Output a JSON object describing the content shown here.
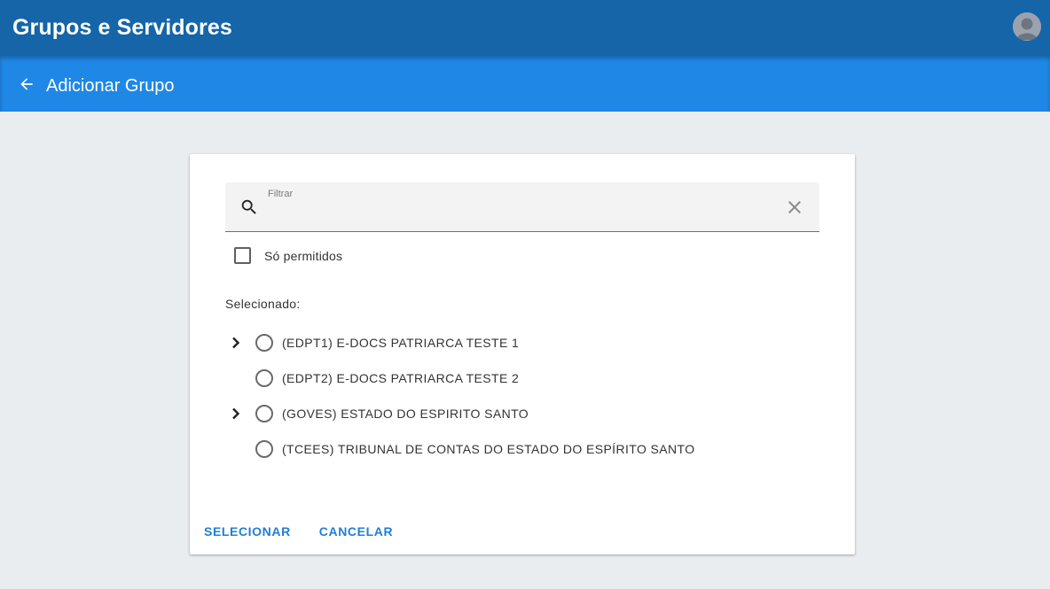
{
  "appbar": {
    "title": "Grupos e Servidores",
    "avatar_icon": "account-avatar-icon"
  },
  "subbar": {
    "back_icon": "arrow-back-icon",
    "title": "Adicionar Grupo"
  },
  "filter": {
    "label": "Filtrar",
    "value": "",
    "search_icon": "search-icon",
    "clear_icon": "close-icon"
  },
  "only_allowed": {
    "label": "Só permitidos",
    "checked": false
  },
  "selected_label": "Selecionado:",
  "tree": [
    {
      "label": "(EDPT1) E-DOCS PATRIARCA TESTE 1",
      "expandable": true,
      "selected": false
    },
    {
      "label": "(EDPT2) E-DOCS PATRIARCA TESTE 2",
      "expandable": false,
      "selected": false
    },
    {
      "label": "(GOVES) ESTADO DO ESPIRITO SANTO",
      "expandable": true,
      "selected": false
    },
    {
      "label": "(TCEES) TRIBUNAL DE CONTAS DO ESTADO DO ESPÍRITO SANTO",
      "expandable": false,
      "selected": false
    }
  ],
  "actions": {
    "select_label": "SELECIONAR",
    "cancel_label": "CANCELAR"
  },
  "colors": {
    "appbar": "#1565a8",
    "subbar": "#1f87e5",
    "background": "#eaedf0",
    "action_text": "#1f7fd6"
  }
}
